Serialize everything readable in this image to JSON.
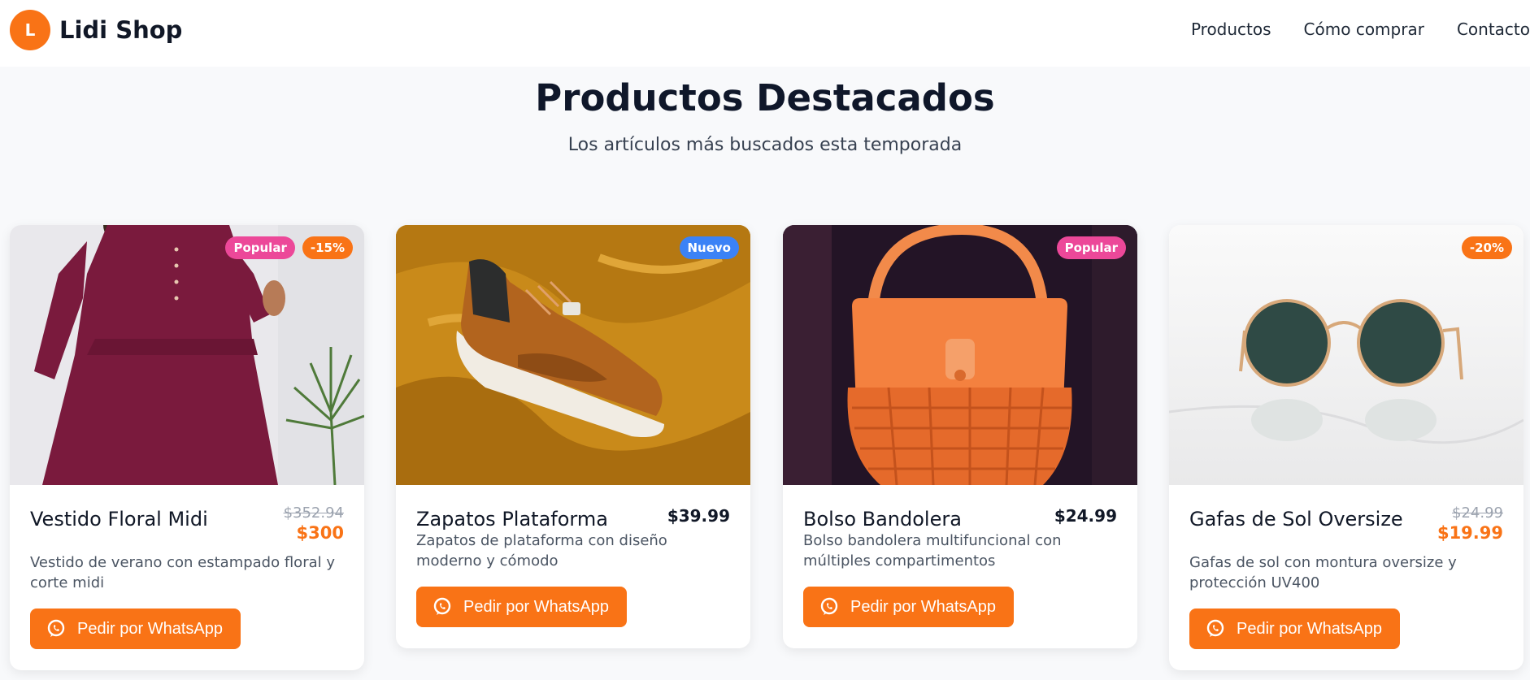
{
  "brand": {
    "initial": "L",
    "name": "Lidi Shop"
  },
  "nav": [
    {
      "label": "Productos"
    },
    {
      "label": "Cómo comprar"
    },
    {
      "label": "Contacto"
    }
  ],
  "section": {
    "title": "Productos Destacados",
    "subtitle": "Los artículos más buscados esta temporada"
  },
  "products": [
    {
      "name": "Vestido Floral Midi",
      "old_price": "$352.94",
      "price": "$300",
      "description": "Vestido de verano con estampado floral y corte midi",
      "badges": [
        "Popular",
        "-15%"
      ],
      "button": "Pedir por WhatsApp",
      "image": "dress-photo"
    },
    {
      "name": "Zapatos Plataforma",
      "price": "$39.99",
      "description": "Zapatos de plataforma con diseño moderno y cómodo",
      "badges": [
        "Nuevo"
      ],
      "button": "Pedir por WhatsApp",
      "image": "sneaker-photo"
    },
    {
      "name": "Bolso Bandolera",
      "price": "$24.99",
      "description": "Bolso bandolera multifuncional con múltiples compartimentos",
      "badges": [
        "Popular"
      ],
      "button": "Pedir por WhatsApp",
      "image": "handbag-photo"
    },
    {
      "name": "Gafas de Sol Oversize",
      "old_price": "$24.99",
      "price": "$19.99",
      "description": "Gafas de sol con montura oversize y protección UV400",
      "badges": [
        "-20%"
      ],
      "button": "Pedir por WhatsApp",
      "image": "sunglasses-photo"
    }
  ],
  "colors": {
    "accent": "#f97316",
    "badge_popular": "#ec4899",
    "badge_new": "#3b82f6"
  },
  "icons": {
    "button": "whatsapp-icon"
  }
}
